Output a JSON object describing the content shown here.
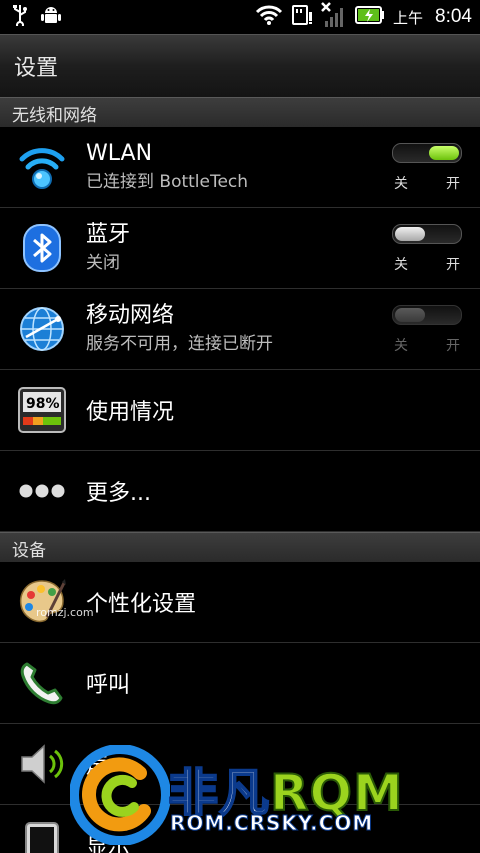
{
  "statusbar": {
    "ampm": "上午",
    "time": "8:04",
    "icons": [
      "usb-icon",
      "android-debug-icon",
      "wifi-icon",
      "sd-card-icon",
      "no-signal-icon",
      "battery-charging-icon"
    ]
  },
  "title": "设置",
  "sections": {
    "network": "无线和网络",
    "device": "设备"
  },
  "rows": [
    {
      "label": "WLAN",
      "sub": "已连接到 BottleTech",
      "icon": "wifi-settings-icon",
      "toggle": "on",
      "off": "关",
      "on": "开"
    },
    {
      "label": "蓝牙",
      "sub": "关闭",
      "icon": "bluetooth-icon",
      "toggle": "off",
      "off": "关",
      "on": "开"
    },
    {
      "label": "移动网络",
      "sub": "服务不可用，连接已断开",
      "icon": "globe-network-icon",
      "toggle": "disabled",
      "off": "关",
      "on": "开"
    },
    {
      "label": "使用情况",
      "icon": "usage-meter-icon",
      "meter": "98%"
    },
    {
      "label": "更多...",
      "icon": "more-dots-icon"
    },
    {
      "label": "个性化设置",
      "icon": "palette-icon"
    },
    {
      "label": "呼叫",
      "icon": "phone-icon"
    },
    {
      "label": "声",
      "icon": "speaker-icon"
    },
    {
      "label": "显示",
      "icon": "display-icon"
    }
  ],
  "watermark": {
    "brand_a": "非凡",
    "brand_b": "RQM",
    "url": "ROM.CRSKY.COM",
    "small": "romzj.com"
  },
  "colors": {
    "toggle_on": "#6cc20b",
    "section_bg": "#333333",
    "accent_blue": "#1e88e5"
  }
}
